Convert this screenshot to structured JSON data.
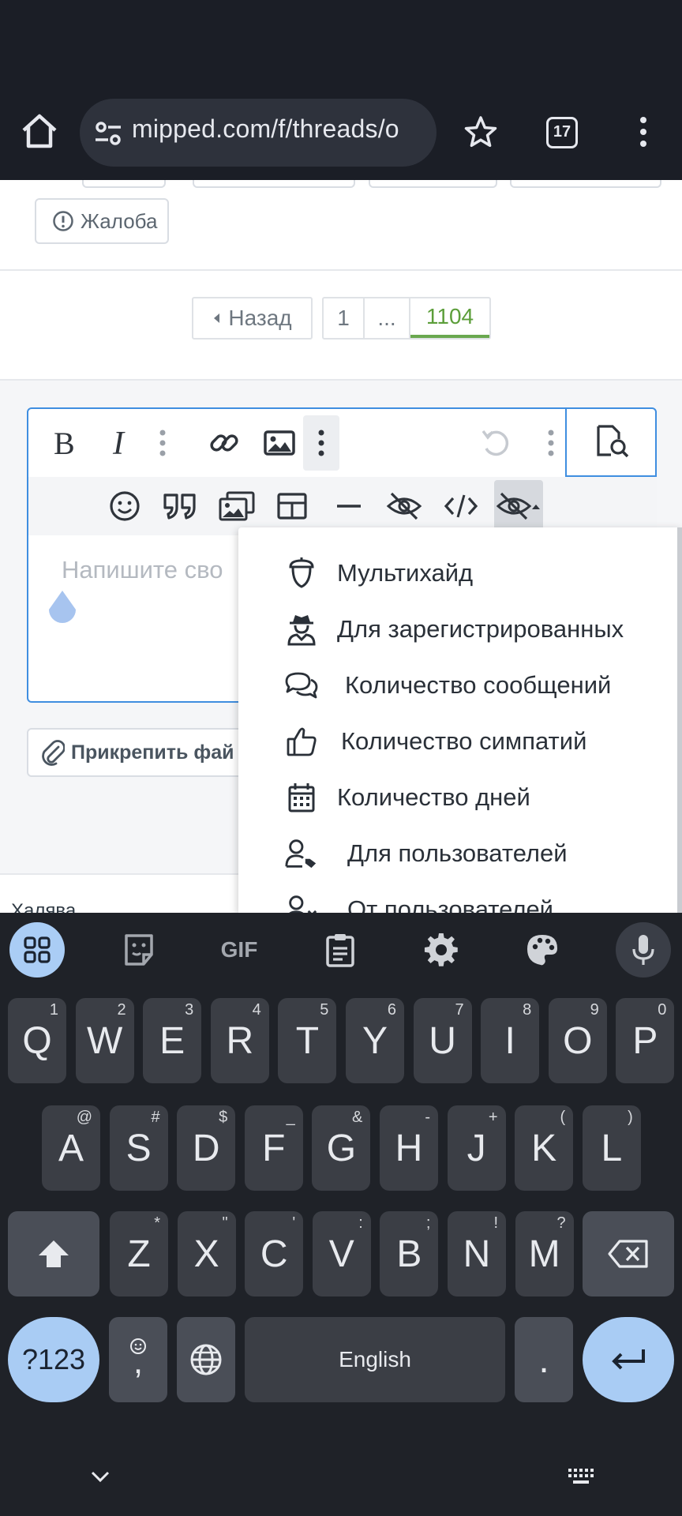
{
  "browser": {
    "url": "mipped.com/f/threads/o",
    "tab_count": "17"
  },
  "post_actions": {
    "report_label": "Жалоба"
  },
  "pagination": {
    "back_label": "Назад",
    "pages": [
      "1",
      "...",
      "1104"
    ],
    "current": "1104"
  },
  "editor": {
    "placeholder": "Напишите сво"
  },
  "attach": {
    "label": "Прикрепить фай"
  },
  "breadcrumb": {
    "label": "Халява"
  },
  "hide_menu": {
    "items": [
      {
        "label": "Мультихайд",
        "icon": "acorn-icon"
      },
      {
        "label": "Для зарегистрированных",
        "icon": "user-detective-icon"
      },
      {
        "label": "Количество сообщений",
        "icon": "comments-icon"
      },
      {
        "label": "Количество симпатий",
        "icon": "thumbs-up-icon"
      },
      {
        "label": "Количество дней",
        "icon": "calendar-icon"
      },
      {
        "label": "Для пользователей",
        "icon": "user-tag-icon"
      },
      {
        "label": "От пользователей",
        "icon": "user-times-icon"
      }
    ]
  },
  "keyboard": {
    "row1": [
      {
        "k": "Q",
        "h": "1"
      },
      {
        "k": "W",
        "h": "2"
      },
      {
        "k": "E",
        "h": "3"
      },
      {
        "k": "R",
        "h": "4"
      },
      {
        "k": "T",
        "h": "5"
      },
      {
        "k": "Y",
        "h": "6"
      },
      {
        "k": "U",
        "h": "7"
      },
      {
        "k": "I",
        "h": "8"
      },
      {
        "k": "O",
        "h": "9"
      },
      {
        "k": "P",
        "h": "0"
      }
    ],
    "row2": [
      {
        "k": "A",
        "h": "@"
      },
      {
        "k": "S",
        "h": "#"
      },
      {
        "k": "D",
        "h": "$"
      },
      {
        "k": "F",
        "h": "_"
      },
      {
        "k": "G",
        "h": "&"
      },
      {
        "k": "H",
        "h": "-"
      },
      {
        "k": "J",
        "h": "+"
      },
      {
        "k": "K",
        "h": "("
      },
      {
        "k": "L",
        "h": ")"
      }
    ],
    "row3": [
      {
        "k": "Z",
        "h": "*"
      },
      {
        "k": "X",
        "h": "\""
      },
      {
        "k": "C",
        "h": "'"
      },
      {
        "k": "V",
        "h": ":"
      },
      {
        "k": "B",
        "h": ";"
      },
      {
        "k": "N",
        "h": "!"
      },
      {
        "k": "M",
        "h": "?"
      }
    ],
    "symbols_label": "?123",
    "comma_label": ",",
    "space_label": "English",
    "period_label": ".",
    "toolbar_gif": "GIF"
  },
  "colors": {
    "accent_blue": "#3f8ee0",
    "current_page_green": "#6aa84f",
    "keyboard_bg": "#1f2228",
    "key_bg": "#3b3e45",
    "key_accent": "#a9ccf4"
  }
}
